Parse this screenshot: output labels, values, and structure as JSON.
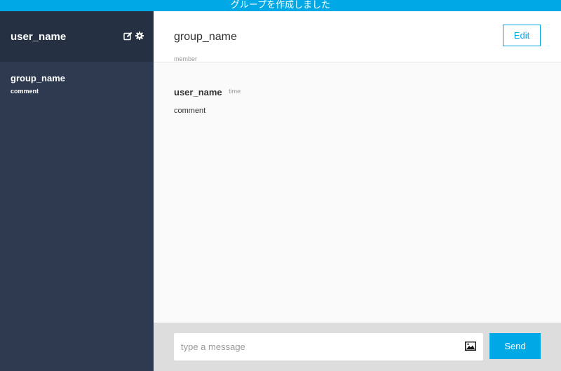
{
  "flash": {
    "message": "グループを作成しました"
  },
  "sidebar": {
    "user_name": "user_name",
    "icons": [
      "edit-icon",
      "gear-icon"
    ],
    "groups": [
      {
        "name": "group_name",
        "last_comment": "comment"
      }
    ]
  },
  "chat": {
    "group_name": "group_name",
    "members_label": "member",
    "edit_label": "Edit",
    "messages": [
      {
        "user": "user_name",
        "time": "time",
        "text": "comment"
      }
    ]
  },
  "form": {
    "placeholder": "type a message",
    "value": "",
    "image_icon": "image-icon",
    "send_label": "Send"
  },
  "colors": {
    "accent": "#00a8e6",
    "sidebar_bg": "#2e3a4f",
    "sidebar_header_bg": "#253142",
    "form_bg": "#dddddd"
  }
}
